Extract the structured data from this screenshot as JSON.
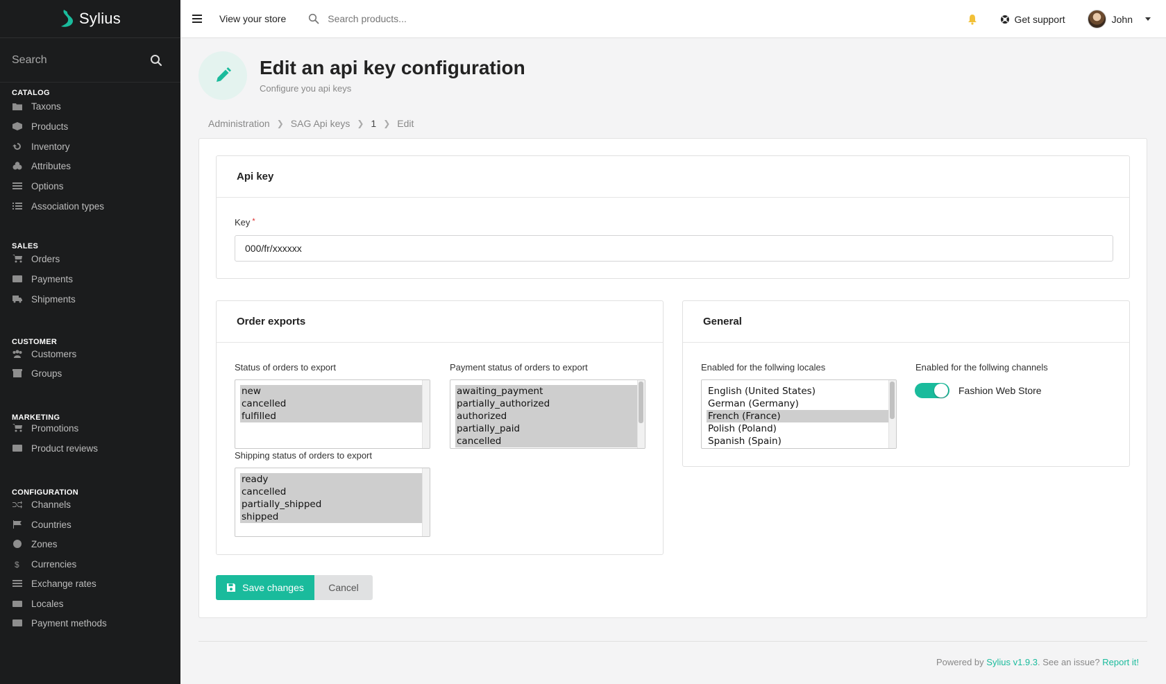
{
  "brand": {
    "name": "Sylius"
  },
  "sidebar": {
    "search_label": "Search",
    "sections": [
      {
        "title": "CATALOG",
        "items": [
          "Taxons",
          "Products",
          "Inventory",
          "Attributes",
          "Options",
          "Association types"
        ]
      },
      {
        "title": "SALES",
        "items": [
          "Orders",
          "Payments",
          "Shipments"
        ]
      },
      {
        "title": "CUSTOMER",
        "items": [
          "Customers",
          "Groups"
        ]
      },
      {
        "title": "MARKETING",
        "items": [
          "Promotions",
          "Product reviews"
        ]
      },
      {
        "title": "CONFIGURATION",
        "items": [
          "Channels",
          "Countries",
          "Zones",
          "Currencies",
          "Exchange rates",
          "Locales",
          "Payment methods"
        ]
      }
    ]
  },
  "topbar": {
    "view_store": "View your store",
    "search_placeholder": "Search products...",
    "support": "Get support",
    "user": "John"
  },
  "header": {
    "title": "Edit an api key configuration",
    "subtitle": "Configure you api keys"
  },
  "breadcrumb": [
    "Administration",
    "SAG Api keys",
    "1",
    "Edit"
  ],
  "api_key": {
    "heading": "Api key",
    "key_label": "Key",
    "key_value": "000/fr/xxxxxx"
  },
  "order_exports": {
    "heading": "Order exports",
    "status_label": "Status of orders to export",
    "status_options": [
      "new",
      "cancelled",
      "fulfilled"
    ],
    "payment_label": "Payment status of orders to export",
    "payment_options": [
      "awaiting_payment",
      "partially_authorized",
      "authorized",
      "partially_paid",
      "cancelled"
    ],
    "shipping_label": "Shipping status of orders to export",
    "shipping_options": [
      "ready",
      "cancelled",
      "partially_shipped",
      "shipped"
    ]
  },
  "general": {
    "heading": "General",
    "locales_label": "Enabled for the follwing locales",
    "locales": [
      "English (United States)",
      "German (Germany)",
      "French (France)",
      "Polish (Poland)",
      "Spanish (Spain)"
    ],
    "selected_locale": "French (France)",
    "channels_label": "Enabled for the follwing channels",
    "channel_name": "Fashion Web Store",
    "channel_enabled": true
  },
  "actions": {
    "save": "Save changes",
    "cancel": "Cancel"
  },
  "footer": {
    "powered_by": "Powered by",
    "version_link": "Sylius v1.9.3",
    "issue_text": ". See an issue?",
    "report_link": "Report it!"
  },
  "colors": {
    "accent": "#1abb9c",
    "sidebar_bg": "#1b1c1d"
  }
}
